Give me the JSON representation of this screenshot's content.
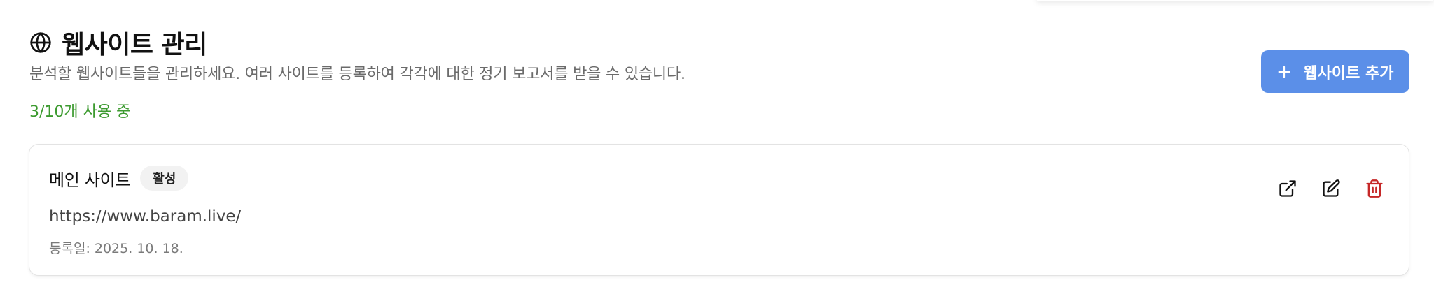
{
  "header": {
    "title": "웹사이트 관리",
    "subtitle": "분석할 웹사이트들을 관리하세요. 여러 사이트를 등록하여 각각에 대한 정기 보고서를 받을 수 있습니다.",
    "usage": "3/10개 사용 중",
    "title_icon": "globe-icon"
  },
  "toolbar": {
    "add_label": "웹사이트 추가",
    "add_icon": "plus-icon"
  },
  "sites": [
    {
      "name": "메인 사이트",
      "status": "활성",
      "url": "https://www.baram.live/",
      "registered": "등록일: 2025. 10. 18.",
      "actions": [
        "external-link-icon",
        "edit-icon",
        "trash-icon"
      ]
    }
  ],
  "colors": {
    "accent": "#5b8fe8",
    "usage_green": "#3c9a2f",
    "delete_red": "#c62828",
    "muted_text": "#6b6b6b"
  }
}
